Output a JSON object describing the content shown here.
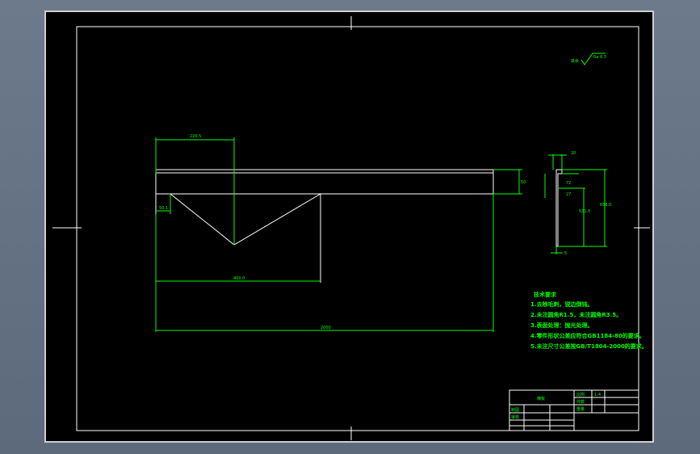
{
  "drawing": {
    "roughness": {
      "prefix": "其余",
      "value": "Ra 6.3"
    },
    "dimensions": {
      "top_width": "226.5",
      "bottom_width": "400.0",
      "total_length": "2000",
      "height_right": "50",
      "small_left": "50.1",
      "side_top": "20",
      "side_a": "72",
      "side_b": "27",
      "side_mid": "531.0",
      "side_total": "656.0",
      "side_bottom": "5"
    },
    "notes": {
      "title": "技术要求",
      "items": [
        "1.去除毛刺，锐边倒钝。",
        "2.未注圆角R1.5，未注圆角R3.5。",
        "3.表面处理：抛光处理。",
        "4.零件形状公差应符合GB1184-80的要求。",
        "5.未注尺寸公差按GB/T1804-2000的要求。"
      ]
    },
    "title_block": {
      "part_name": "横板",
      "scale_label": "比例",
      "scale_value": "1:4",
      "qty_label": "件数",
      "weight_label": "重量",
      "drawn_label": "制图",
      "checked_label": "审核"
    },
    "colors": {
      "outline": "#ffffff",
      "annotation": "#00ff00",
      "background": "#000000"
    }
  }
}
